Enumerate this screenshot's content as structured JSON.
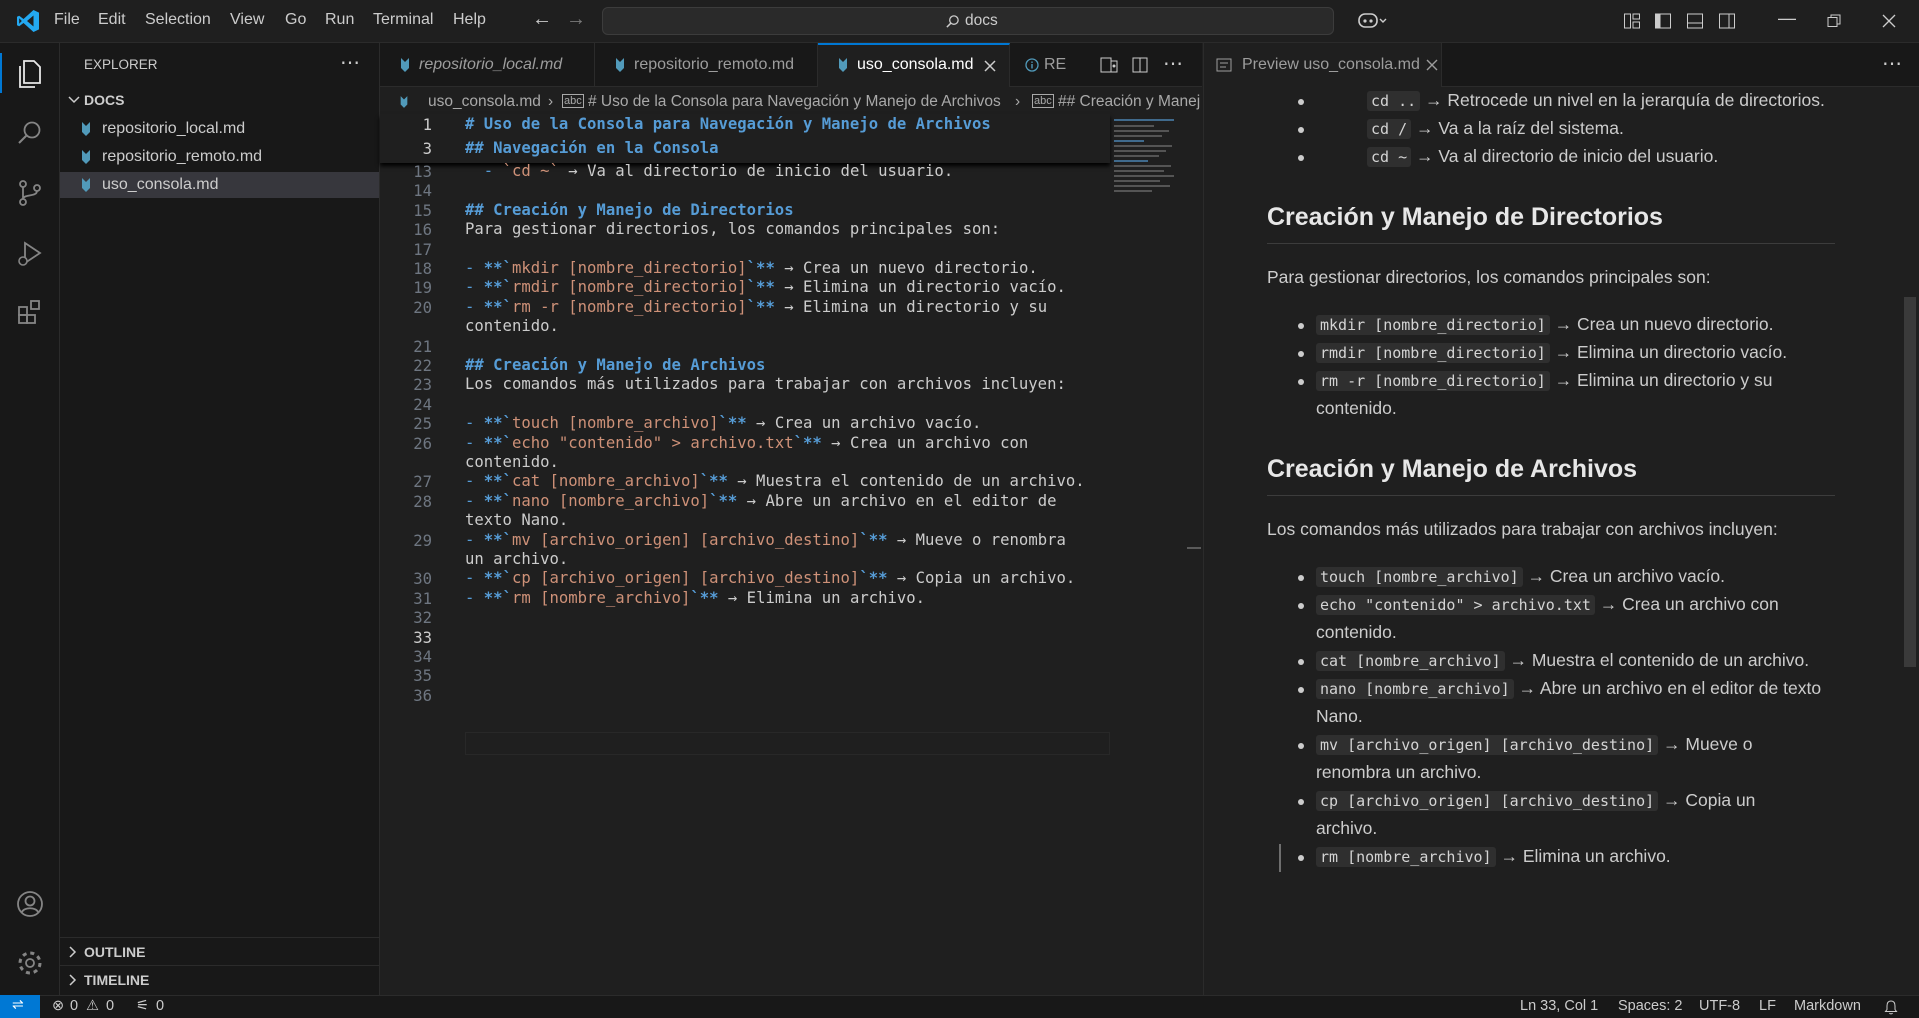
{
  "menu": [
    "File",
    "Edit",
    "Selection",
    "View",
    "Go",
    "Run",
    "Terminal",
    "Help"
  ],
  "search": {
    "text": "docs"
  },
  "sidebar": {
    "title": "EXPLORER",
    "folder": "DOCS",
    "files": [
      "repositorio_local.md",
      "repositorio_remoto.md",
      "uso_consola.md"
    ],
    "outline": "OUTLINE",
    "timeline": "TIMELINE"
  },
  "tabs": [
    "repositorio_local.md",
    "repositorio_remoto.md",
    "uso_consola.md",
    "RE"
  ],
  "breadcrumb": {
    "file": "uso_consola.md",
    "h1": "# Uso de la Consola para Navegación y Manejo de Archivos",
    "h2": "## Creación y Manej"
  },
  "editor": {
    "sticky": [
      {
        "n": "1",
        "text": "# Uso de la Consola para Navegación y Manejo de Archivos"
      },
      {
        "n": "3",
        "text": "## Navegación en la Consola"
      }
    ],
    "lines": [
      {
        "n": "13",
        "text": "  - `cd ~` → Va al directorio de inicio del usuario."
      },
      {
        "n": "14",
        "text": ""
      },
      {
        "n": "15",
        "text": "## Creación y Manejo de Directorios"
      },
      {
        "n": "16",
        "text": "Para gestionar directorios, los comandos principales son:"
      },
      {
        "n": "17",
        "text": ""
      },
      {
        "n": "18",
        "text": "- **`mkdir [nombre_directorio]`** → Crea un nuevo directorio."
      },
      {
        "n": "19",
        "text": "- **`rmdir [nombre_directorio]`** → Elimina un directorio vacío."
      },
      {
        "n": "20",
        "text": "- **`rm -r [nombre_directorio]`** → Elimina un directorio y su"
      },
      {
        "n": "",
        "text": "contenido."
      },
      {
        "n": "21",
        "text": ""
      },
      {
        "n": "22",
        "text": "## Creación y Manejo de Archivos"
      },
      {
        "n": "23",
        "text": "Los comandos más utilizados para trabajar con archivos incluyen:"
      },
      {
        "n": "24",
        "text": ""
      },
      {
        "n": "25",
        "text": "- **`touch [nombre_archivo]`** → Crea un archivo vacío."
      },
      {
        "n": "26",
        "text": "- **`echo \"contenido\" > archivo.txt`** → Crea un archivo con"
      },
      {
        "n": "",
        "text": "contenido."
      },
      {
        "n": "27",
        "text": "- **`cat [nombre_archivo]`** → Muestra el contenido de un archivo."
      },
      {
        "n": "28",
        "text": "- **`nano [nombre_archivo]`** → Abre un archivo en el editor de"
      },
      {
        "n": "",
        "text": "texto Nano."
      },
      {
        "n": "29",
        "text": "- **`mv [archivo_origen] [archivo_destino]`** → Mueve o renombra"
      },
      {
        "n": "",
        "text": "un archivo."
      },
      {
        "n": "30",
        "text": "- **`cp [archivo_origen] [archivo_destino]`** → Copia un archivo."
      },
      {
        "n": "31",
        "text": "- **`rm [nombre_archivo]`** → Elimina un archivo."
      },
      {
        "n": "32",
        "text": ""
      },
      {
        "n": "33",
        "text": ""
      },
      {
        "n": "34",
        "text": ""
      },
      {
        "n": "35",
        "text": ""
      },
      {
        "n": "36",
        "text": ""
      }
    ]
  },
  "preview": {
    "tab": "Preview uso_consola.md",
    "top_items": [
      {
        "code": "cd ..",
        "text": " → Retrocede un nivel en la jerarquía de directorios."
      },
      {
        "code": "cd /",
        "text": " → Va a la raíz del sistema."
      },
      {
        "code": "cd ~",
        "text": " → Va al directorio de inicio del usuario."
      }
    ],
    "h_dirs": "Creación y Manejo de Directorios",
    "p_dirs": "Para gestionar directorios, los comandos principales son:",
    "dir_items": [
      {
        "code": "mkdir [nombre_directorio]",
        "text": " → Crea un nuevo directorio."
      },
      {
        "code": "rmdir [nombre_directorio]",
        "text": " → Elimina un directorio vacío."
      },
      {
        "code": "rm -r [nombre_directorio]",
        "text": " → Elimina un directorio y su",
        "cont": "contenido."
      }
    ],
    "h_files": "Creación y Manejo de Archivos",
    "p_files": "Los comandos más utilizados para trabajar con archivos incluyen:",
    "file_items": [
      {
        "code": "touch [nombre_archivo]",
        "text": " → Crea un archivo vacío."
      },
      {
        "code": "echo \"contenido\" > archivo.txt",
        "text": " → Crea un archivo con",
        "cont": "contenido."
      },
      {
        "code": "cat [nombre_archivo]",
        "text": " → Muestra el contenido de un archivo."
      },
      {
        "code": "nano [nombre_archivo]",
        "text": " → Abre un archivo en el editor de texto",
        "cont": "Nano."
      },
      {
        "code": "mv [archivo_origen] [archivo_destino]",
        "text": " → Mueve o",
        "cont": "renombra un archivo."
      },
      {
        "code": "cp [archivo_origen] [archivo_destino]",
        "text": " → Copia un",
        "cont": "archivo."
      },
      {
        "code": "rm [nombre_archivo]",
        "text": " → Elimina un archivo."
      }
    ]
  },
  "status": {
    "errors": "0",
    "warnings": "0",
    "ports": "0",
    "position": "Ln 33, Col 1",
    "spaces": "Spaces: 2",
    "encoding": "UTF-8",
    "eol": "LF",
    "language": "Markdown"
  },
  "colors": {
    "accent": "#0078d4",
    "md_icon": "#519aba",
    "heading": "#569cd6"
  }
}
